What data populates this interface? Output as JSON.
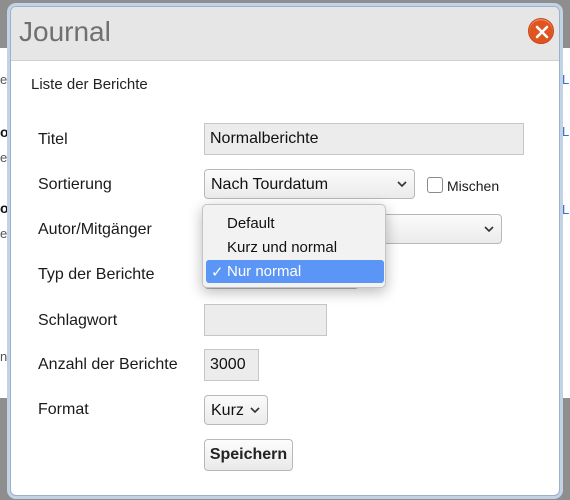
{
  "background": {
    "fragments": [
      "et",
      "o",
      "er",
      "o",
      "er",
      "nb",
      "L",
      "L",
      "L"
    ]
  },
  "dialog": {
    "title": "Journal",
    "subtitle": "Liste der Berichte",
    "close_icon": "close-icon"
  },
  "form": {
    "titel": {
      "label": "Titel",
      "value": "Normalberichte"
    },
    "sortierung": {
      "label": "Sortierung",
      "value": "Nach Tourdatum",
      "mischen_label": "Mischen",
      "mischen_checked": false
    },
    "autor": {
      "label": "Autor/Mitgänger",
      "value": ""
    },
    "typ": {
      "label": "Typ der Berichte",
      "options": [
        {
          "label": "Default",
          "selected": false
        },
        {
          "label": "Kurz und normal",
          "selected": false
        },
        {
          "label": "Nur normal",
          "selected": true
        }
      ],
      "check_mark": "✓"
    },
    "schlagwort": {
      "label": "Schlagwort",
      "value": ""
    },
    "anzahl": {
      "label": "Anzahl der Berichte",
      "value": "3000"
    },
    "format": {
      "label": "Format",
      "value": "Kurz"
    },
    "save_label": "Speichern"
  },
  "colors": {
    "accent": "#5b95f6",
    "close": "#e0541f"
  }
}
